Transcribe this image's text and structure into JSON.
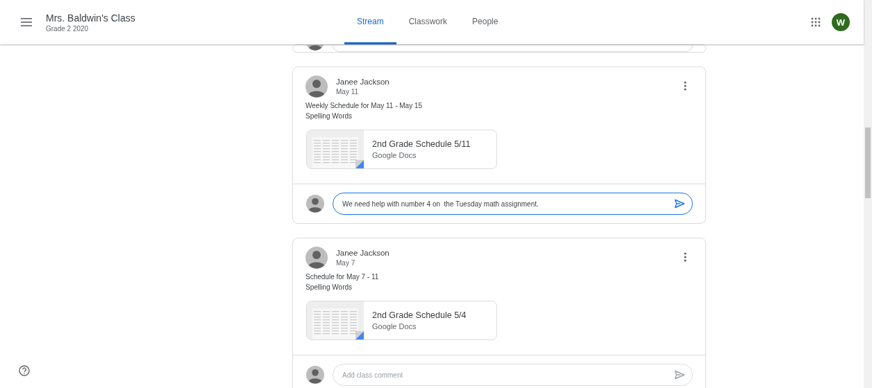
{
  "header": {
    "class_name": "Mrs. Baldwin's Class",
    "section": "Grade 2 2020",
    "avatar_letter": "W"
  },
  "tabs": [
    {
      "label": "Stream",
      "selected": true
    },
    {
      "label": "Classwork",
      "selected": false
    },
    {
      "label": "People",
      "selected": false
    }
  ],
  "previous_post": {
    "kind": "clipped-comment-row"
  },
  "posts": [
    {
      "author": "Janee Jackson",
      "date": "May 11",
      "lines": [
        "Weekly Schedule for May 11 - May 15",
        "Spelling Words"
      ],
      "attachment": {
        "title": "2nd Grade Schedule 5/11",
        "type": "Google Docs"
      },
      "comment": {
        "value": "We need help with number 4 on  the Tuesday math assignment.",
        "focused": true
      }
    },
    {
      "author": "Janee Jackson",
      "date": "May 7",
      "lines": [
        "Schedule for May 7 - 11",
        "Spelling Words"
      ],
      "attachment": {
        "title": "2nd Grade Schedule 5/4",
        "type": "Google Docs"
      },
      "comment": {
        "placeholder": "Add class comment",
        "focused": false
      }
    }
  ]
}
